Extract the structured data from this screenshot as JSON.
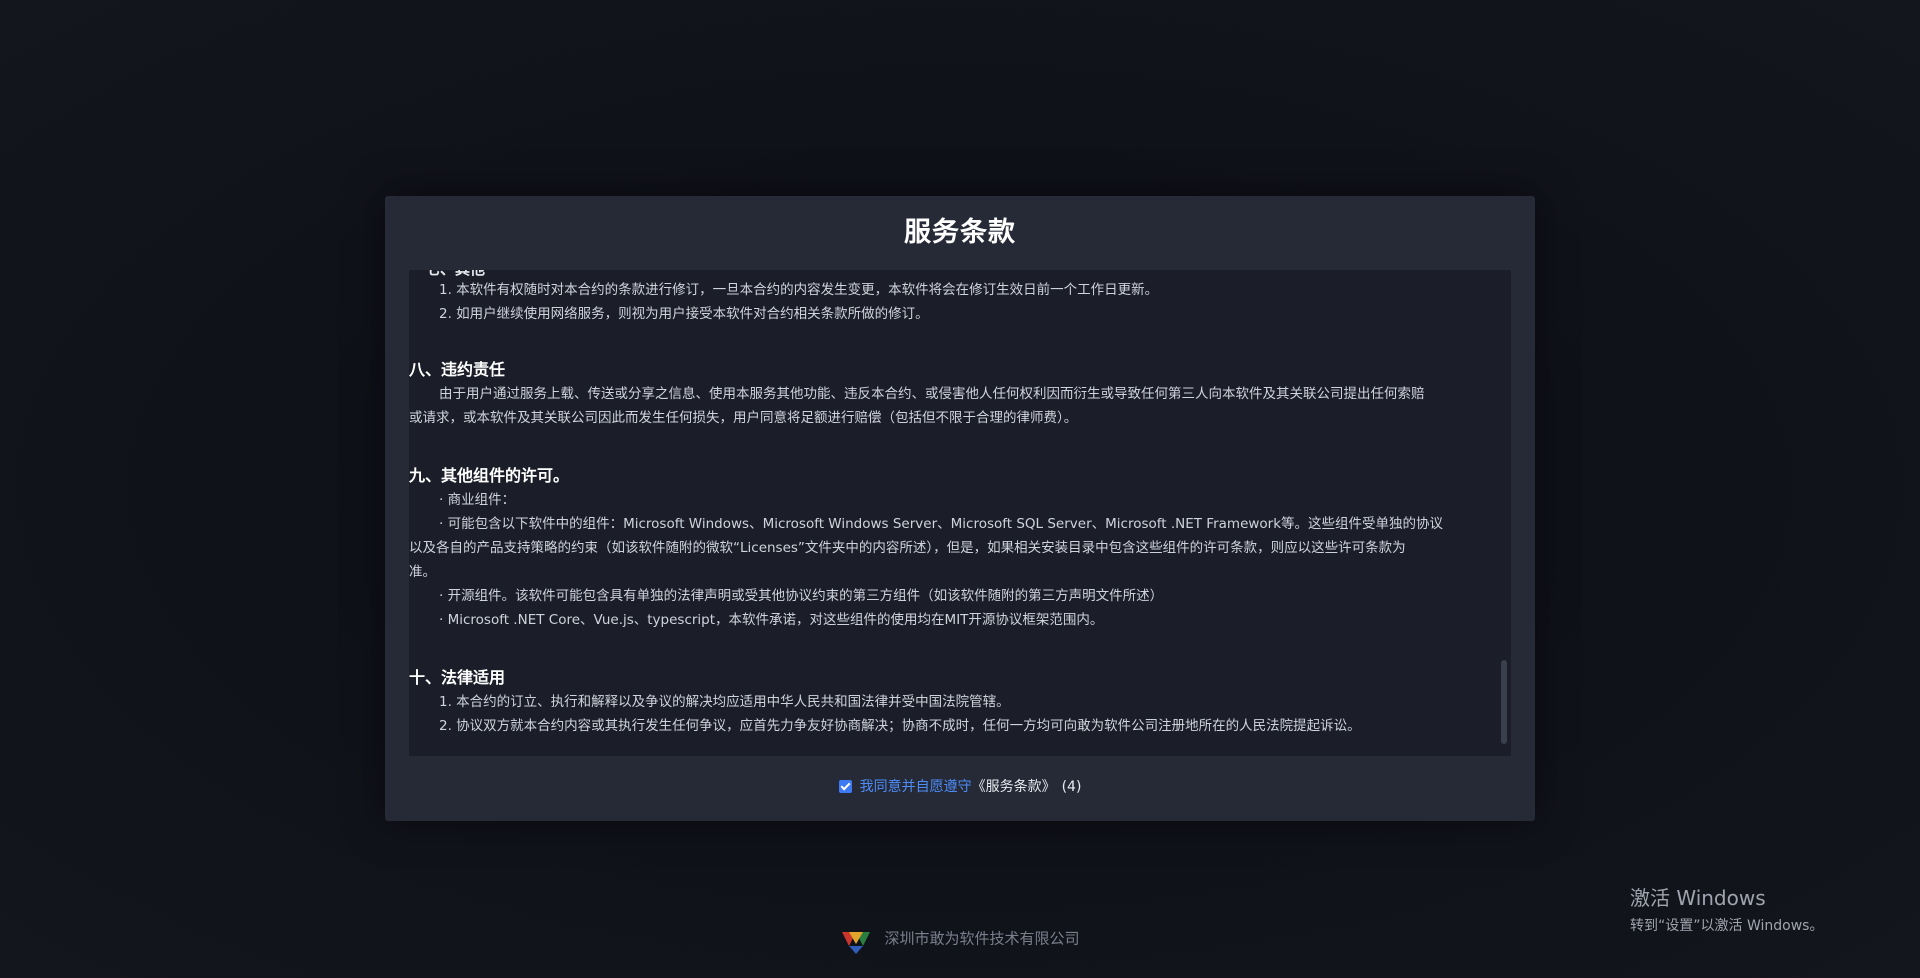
{
  "modal": {
    "title": "服务条款"
  },
  "content": {
    "partial_heading": "七、其他",
    "lines": [
      "1. 本软件有权随时对本合约的条款进行修订，一旦本合约的内容发生变更，本软件将会在修订生效日前一个工作日更新。",
      "2. 如用户继续使用网络服务，则视为用户接受本软件对合约相关条款所做的修订。"
    ],
    "section8": {
      "title": "八、违约责任",
      "lines": [
        "由于用户通过服务上载、传送或分享之信息、使用本服务其他功能、违反本合约、或侵害他人任何权利因而衍生或导致任何第三人向本软件及其关联公司提出任何索赔",
        "或请求，或本软件及其关联公司因此而发生任何损失，用户同意将足额进行赔偿（包括但不限于合理的律师费）。"
      ]
    },
    "section9": {
      "title": "九、其他组件的许可。",
      "lines": [
        "· 商业组件：",
        "· 可能包含以下软件中的组件：Microsoft Windows、Microsoft Windows Server、Microsoft SQL Server、Microsoft .NET Framework等。这些组件受单独的协议",
        "以及各自的产品支持策略的约束（如该软件随附的微软“Licenses”文件夹中的内容所述），但是，如果相关安装目录中包含这些组件的许可条款，则应以这些许可条款为",
        "准。",
        "· 开源组件。该软件可能包含具有单独的法律声明或受其他协议约束的第三方组件（如该软件随附的第三方声明文件所述）",
        "· Microsoft .NET Core、Vue.js、typescript，本软件承诺，对这些组件的使用均在MIT开源协议框架范围内。"
      ]
    },
    "section10": {
      "title": "十、法律适用",
      "lines": [
        "1. 本合约的订立、执行和解释以及争议的解决均应适用中华人民共和国法律并受中国法院管辖。",
        "2. 协议双方就本合约内容或其执行发生任何争议，应首先力争友好协商解决；协商不成时，任何一方均可向敢为软件公司注册地所在的人民法院提起诉讼。"
      ]
    }
  },
  "agree": {
    "text": "我同意并自愿遵守",
    "terms_link": "《服务条款》",
    "countdown": "(4)",
    "checked": true,
    "color": "#4d8cf7"
  },
  "footer": {
    "company": "深圳市敢为软件技术有限公司"
  },
  "windows_watermark": {
    "title": "激活 Windows",
    "subtitle": "转到“设置”以激活 Windows。"
  }
}
